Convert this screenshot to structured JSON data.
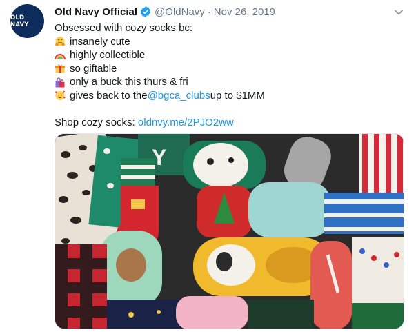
{
  "tweet": {
    "avatar_text": "OLD NAVY",
    "display_name": "Old Navy Official",
    "handle": "@OldNavy",
    "separator": "·",
    "date": "Nov 26, 2019",
    "lines": {
      "intro": "Obsessed with cozy socks bc:",
      "l1": "insanely cute",
      "l2": "highly collectible",
      "l3": "so giftable",
      "l4": "only a buck this thurs & fri",
      "l5_pre": "gives back to the ",
      "l5_mention": "@bgca_clubs",
      "l5_post": " up to $1MM",
      "shop_pre": "Shop cozy socks: ",
      "shop_link": "oldnvy.me/2PJO2ww"
    },
    "emojis": [
      "hugging-face-icon",
      "rainbow-icon",
      "wrapped-gift-icon",
      "shopping-bags-icon",
      "smiling-face-with-hearts-icon"
    ],
    "colors": {
      "link": "#1b95e0",
      "secondary": "#657786",
      "verified": "#1da1f2",
      "avatar_bg": "#0f2d5c"
    }
  }
}
